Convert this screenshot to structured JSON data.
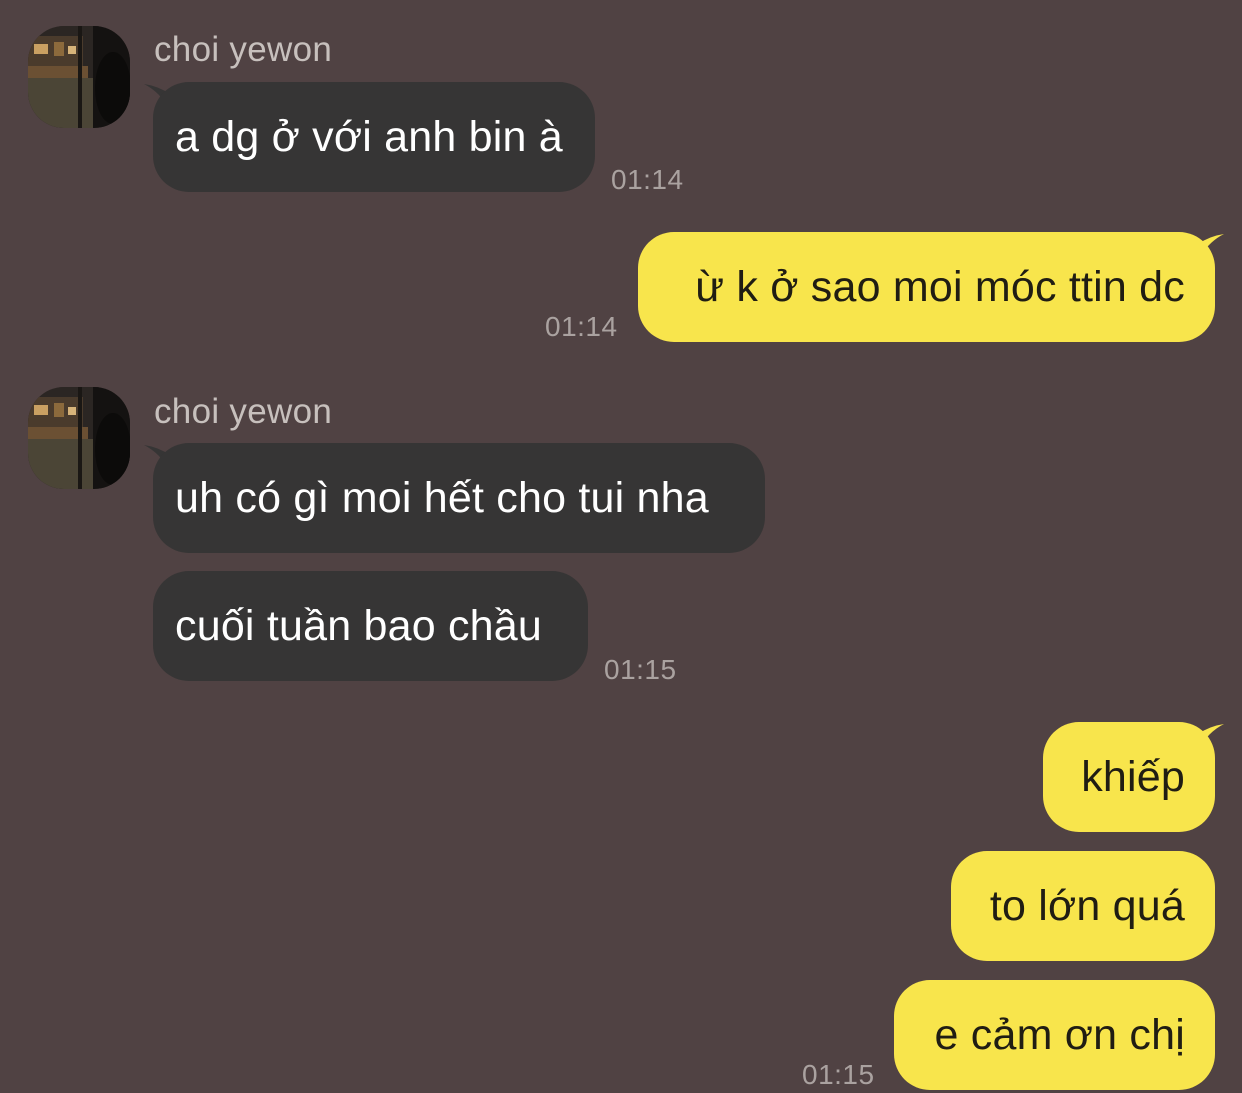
{
  "chat": {
    "contact_name": "choi yewon",
    "messages": [
      {
        "text": "a dg ở với anh bin à",
        "time": "01:14"
      },
      {
        "text": "ừ k ở sao moi móc ttin dc",
        "time": "01:14"
      },
      {
        "text": "uh có gì moi hết cho tui nha"
      },
      {
        "text": "cuối tuần bao chầu",
        "time": "01:15"
      },
      {
        "text": "khiếp"
      },
      {
        "text": "to lớn quá"
      },
      {
        "text": "e cảm ơn chị",
        "time": "01:15"
      }
    ]
  },
  "colors": {
    "background": "#504243",
    "incoming_bubble": "#363535",
    "outgoing_bubble": "#f8e54c",
    "timestamp": "#aaa2a0",
    "sender_name": "#c7c0bd"
  },
  "icons": {
    "avatar": "profile-photo"
  }
}
